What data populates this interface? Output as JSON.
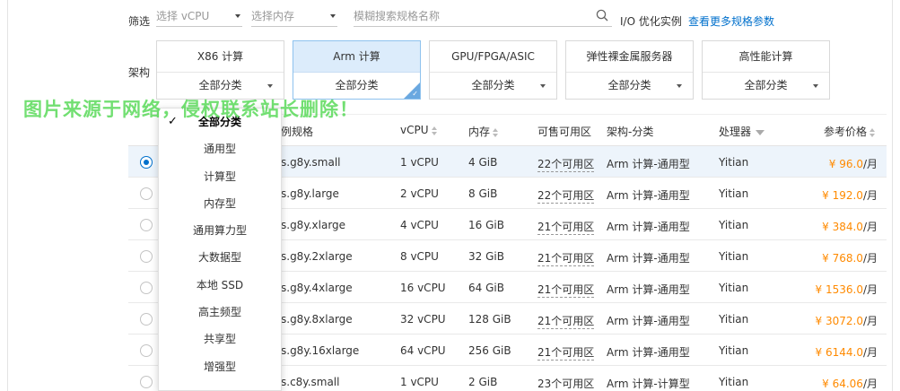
{
  "filter": {
    "label": "筛选",
    "vcpu_placeholder": "选择 vCPU",
    "mem_placeholder": "选择内存",
    "search_placeholder": "模糊搜索规格名称",
    "io_label": "I/O 优化实例",
    "more_link": "查看更多规格参数"
  },
  "arch": {
    "label": "架构",
    "cards": [
      {
        "title": "X86 计算",
        "sub": "全部分类"
      },
      {
        "title": "Arm 计算",
        "sub": "全部分类"
      },
      {
        "title": "GPU/FPGA/ASIC",
        "sub": "全部分类"
      },
      {
        "title": "弹性裸金属服务器",
        "sub": "全部分类"
      },
      {
        "title": "高性能计算",
        "sub": "全部分类"
      }
    ]
  },
  "dropdown": {
    "items": [
      "全部分类",
      "通用型",
      "计算型",
      "内存型",
      "通用算力型",
      "大数据型",
      "本地 SSD",
      "高主频型",
      "共享型",
      "增强型"
    ]
  },
  "table": {
    "headers": {
      "spec": "例规格",
      "vcpu": "vCPU",
      "mem": "内存",
      "zone": "可售可用区",
      "arch": "架构-分类",
      "cpu": "处理器",
      "price": "参考价格"
    },
    "rows": [
      {
        "spec": "s.g8y.small",
        "vcpu": "1 vCPU",
        "mem": "4 GiB",
        "zone": "22个可用区",
        "arch": "Arm 计算-通用型",
        "cpu": "Yitian",
        "price": "¥ 96.0",
        "unit": "/月"
      },
      {
        "spec": "s.g8y.large",
        "vcpu": "2 vCPU",
        "mem": "8 GiB",
        "zone": "22个可用区",
        "arch": "Arm 计算-通用型",
        "cpu": "Yitian",
        "price": "¥ 192.0",
        "unit": "/月"
      },
      {
        "spec": "s.g8y.xlarge",
        "vcpu": "4 vCPU",
        "mem": "16 GiB",
        "zone": "21个可用区",
        "arch": "Arm 计算-通用型",
        "cpu": "Yitian",
        "price": "¥ 384.0",
        "unit": "/月"
      },
      {
        "spec": "s.g8y.2xlarge",
        "vcpu": "8 vCPU",
        "mem": "32 GiB",
        "zone": "21个可用区",
        "arch": "Arm 计算-通用型",
        "cpu": "Yitian",
        "price": "¥ 768.0",
        "unit": "/月"
      },
      {
        "spec": "s.g8y.4xlarge",
        "vcpu": "16 vCPU",
        "mem": "64 GiB",
        "zone": "21个可用区",
        "arch": "Arm 计算-通用型",
        "cpu": "Yitian",
        "price": "¥ 1536.0",
        "unit": "/月"
      },
      {
        "spec": "s.g8y.8xlarge",
        "vcpu": "32 vCPU",
        "mem": "128 GiB",
        "zone": "21个可用区",
        "arch": "Arm 计算-通用型",
        "cpu": "Yitian",
        "price": "¥ 3072.0",
        "unit": "/月"
      },
      {
        "spec": "s.g8y.16xlarge",
        "vcpu": "64 vCPU",
        "mem": "256 GiB",
        "zone": "21个可用区",
        "arch": "Arm 计算-通用型",
        "cpu": "Yitian",
        "price": "¥ 6144.0",
        "unit": "/月"
      },
      {
        "spec": "s.c8y.small",
        "vcpu": "1 vCPU",
        "mem": "2 GiB",
        "zone": "23个可用区",
        "arch": "Arm 计算-计算型",
        "cpu": "Yitian",
        "price": "¥ 64.06",
        "unit": "/月"
      }
    ]
  },
  "watermark": "图片来源于网络，侵权联系站长删除！",
  "colors": {
    "link": "#0070cc",
    "price": "#ff8a00",
    "active_card_bg": "#dcecfb",
    "watermark": "#3cd23c"
  }
}
